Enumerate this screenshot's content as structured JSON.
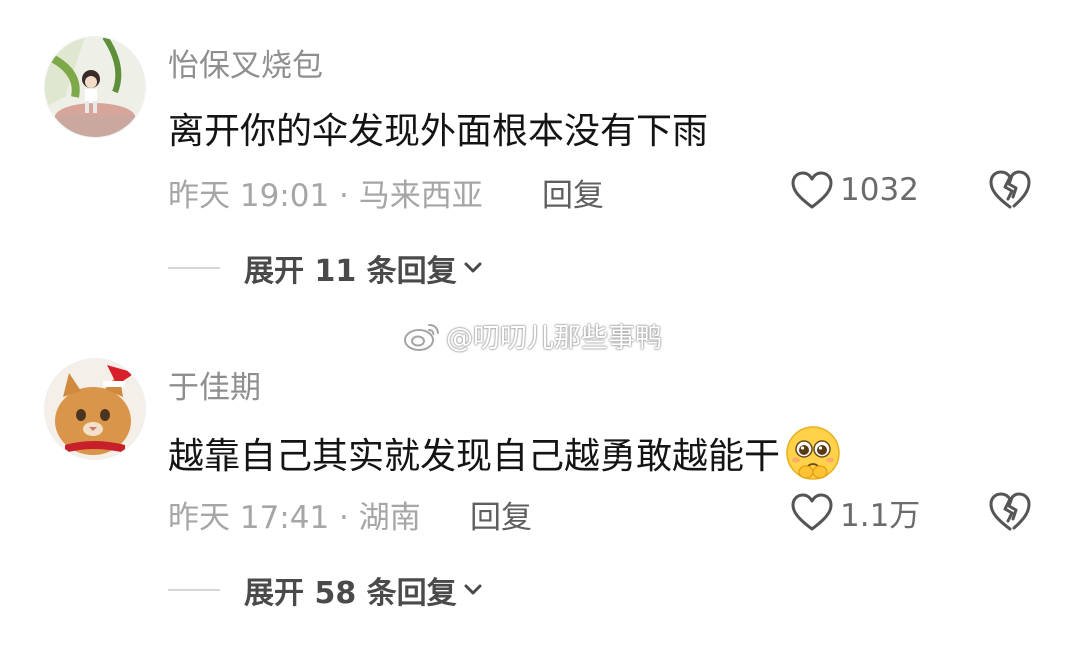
{
  "watermark": {
    "text": "@叨叨儿那些事鸭",
    "icon": "weibo-icon"
  },
  "comments": [
    {
      "username": "怡保叉烧包",
      "avatar": "figurine-avatar",
      "text": "离开你的伞发现外面根本没有下雨",
      "meta": "昨天 19:01 · 马来西亚",
      "reply_label": "回复",
      "likes": "1032",
      "expand_label": "展开 11 条回复"
    },
    {
      "username": "于佳期",
      "avatar": "cat-avatar",
      "text": "越靠自己其实就发现自己越勇敢越能干",
      "emoji": "pleading-face-emoji",
      "meta": "昨天 17:41 · 湖南",
      "reply_label": "回复",
      "likes": "1.1万",
      "expand_label": "展开 58 条回复"
    }
  ]
}
